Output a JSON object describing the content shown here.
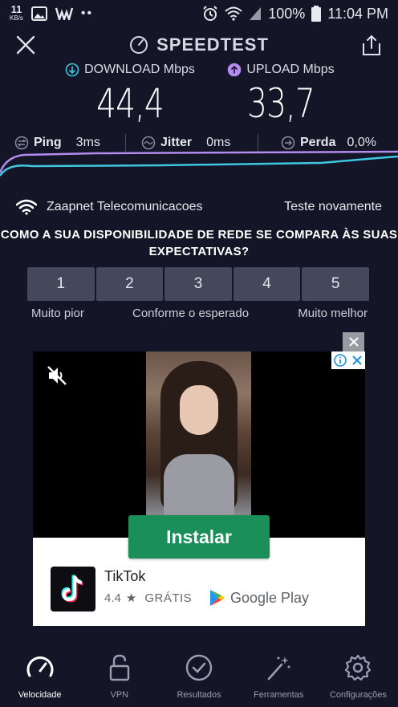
{
  "status_bar": {
    "speed_value": "11",
    "speed_unit": "KB/s",
    "battery": "100%",
    "time": "11:04 PM"
  },
  "header": {
    "title": "SPEEDTEST"
  },
  "results": {
    "download_label": "DOWNLOAD Mbps",
    "download_value": "44,4",
    "upload_label": "UPLOAD Mbps",
    "upload_value": "33,7",
    "ping_label": "Ping",
    "ping_value": "3ms",
    "jitter_label": "Jitter",
    "jitter_value": "0ms",
    "loss_label": "Perda",
    "loss_value": "0,0%"
  },
  "network": {
    "provider": "Zaapnet Telecomunicacoes",
    "retest_label": "Teste novamente"
  },
  "survey": {
    "question": "COMO A SUA DISPONIBILIDADE DE REDE SE COMPARA ÀS SUAS EXPECTATIVAS?",
    "options": [
      "1",
      "2",
      "3",
      "4",
      "5"
    ],
    "label_low": "Muito pior",
    "label_mid": "Conforme o esperado",
    "label_high": "Muito melhor"
  },
  "ad": {
    "install_label": "Instalar",
    "app_name": "TikTok",
    "rating": "4.4",
    "price": "GRÁTIS",
    "store_name": "Google Play"
  },
  "bottom_nav": {
    "items": [
      {
        "label": "Velocidade",
        "icon": "speedometer-icon",
        "active": true
      },
      {
        "label": "VPN",
        "icon": "lock-icon",
        "active": false
      },
      {
        "label": "Resultados",
        "icon": "check-circle-icon",
        "active": false
      },
      {
        "label": "Ferramentas",
        "icon": "magic-wand-icon",
        "active": false
      },
      {
        "label": "Configurações",
        "icon": "gear-icon",
        "active": false
      }
    ]
  },
  "colors": {
    "background": "#141526",
    "download_accent": "#3fc7e0",
    "upload_accent": "#b48cf0",
    "install_button": "#1a8f5a"
  }
}
